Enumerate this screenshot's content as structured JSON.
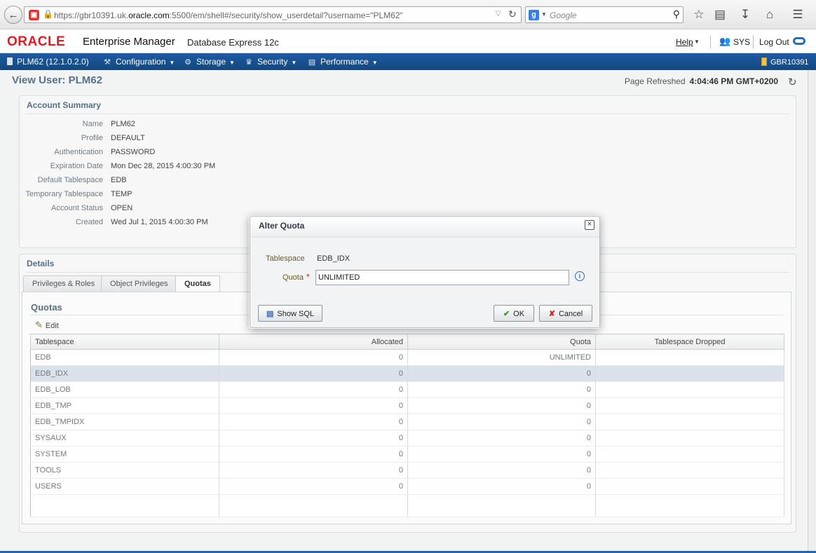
{
  "browser": {
    "url_prefix": "https://gbr10391.uk.",
    "url_domain": "oracle.com",
    "url_suffix": ":5500/em/shell#/security/show_userdetail?username=\"PLM62\"",
    "search_placeholder": "Google"
  },
  "header": {
    "logo": "ORACLE",
    "product": "Enterprise Manager",
    "edition": "Database Express 12c",
    "help": "Help",
    "user": "SYS",
    "logout": "Log Out"
  },
  "nav": {
    "db": "PLM62 (12.1.0.2.0)",
    "items": [
      "Configuration",
      "Storage",
      "Security",
      "Performance"
    ],
    "host": "GBR10391"
  },
  "page": {
    "title": "View User: PLM62",
    "refreshed_label": "Page Refreshed",
    "refreshed_time": "4:04:46 PM GMT+0200"
  },
  "account_summary": {
    "title": "Account Summary",
    "fields": [
      {
        "label": "Name",
        "value": "PLM62"
      },
      {
        "label": "Profile",
        "value": "DEFAULT"
      },
      {
        "label": "Authentication",
        "value": "PASSWORD"
      },
      {
        "label": "Expiration Date",
        "value": "Mon Dec 28, 2015 4:00:30 PM"
      },
      {
        "label": "Default Tablespace",
        "value": "EDB"
      },
      {
        "label": "Temporary Tablespace",
        "value": "TEMP"
      },
      {
        "label": "Account Status",
        "value": "OPEN"
      },
      {
        "label": "Created",
        "value": "Wed Jul 1, 2015 4:00:30 PM"
      }
    ]
  },
  "details": {
    "title": "Details",
    "tabs": [
      "Privileges & Roles",
      "Object Privileges",
      "Quotas"
    ],
    "quotas_title": "Quotas",
    "edit": "Edit",
    "columns": [
      "Tablespace",
      "Allocated",
      "Quota",
      "Tablespace Dropped"
    ],
    "rows": [
      {
        "tablespace": "EDB",
        "allocated": "0",
        "quota": "UNLIMITED",
        "dropped": ""
      },
      {
        "tablespace": "EDB_IDX",
        "allocated": "0",
        "quota": "0",
        "dropped": ""
      },
      {
        "tablespace": "EDB_LOB",
        "allocated": "0",
        "quota": "0",
        "dropped": ""
      },
      {
        "tablespace": "EDB_TMP",
        "allocated": "0",
        "quota": "0",
        "dropped": ""
      },
      {
        "tablespace": "EDB_TMPIDX",
        "allocated": "0",
        "quota": "0",
        "dropped": ""
      },
      {
        "tablespace": "SYSAUX",
        "allocated": "0",
        "quota": "0",
        "dropped": ""
      },
      {
        "tablespace": "SYSTEM",
        "allocated": "0",
        "quota": "0",
        "dropped": ""
      },
      {
        "tablespace": "TOOLS",
        "allocated": "0",
        "quota": "0",
        "dropped": ""
      },
      {
        "tablespace": "USERS",
        "allocated": "0",
        "quota": "0",
        "dropped": ""
      }
    ]
  },
  "dialog": {
    "title": "Alter Quota",
    "tablespace_label": "Tablespace",
    "tablespace_value": "EDB_IDX",
    "quota_label": "Quota",
    "quota_value": "UNLIMITED",
    "show_sql": "Show SQL",
    "ok": "OK",
    "cancel": "Cancel"
  }
}
